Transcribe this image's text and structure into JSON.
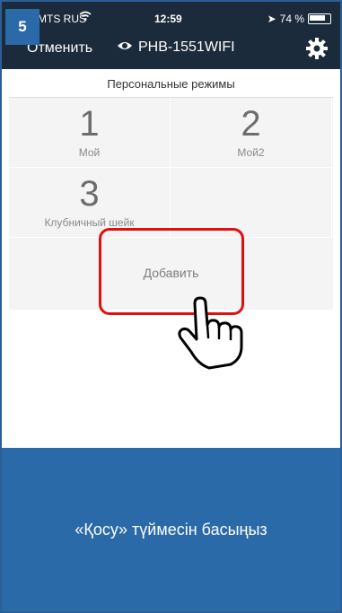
{
  "step_number": "5",
  "status_bar": {
    "carrier": "MTS RUS",
    "time": "12:59",
    "battery": "74 %"
  },
  "header": {
    "cancel_label": "Отменить",
    "device_name": "PHB-1551WIFI"
  },
  "section_title": "Персональные режимы",
  "modes": [
    {
      "number": "1",
      "name": "Мой"
    },
    {
      "number": "2",
      "name": "Мой2"
    },
    {
      "number": "3",
      "name": "Клубничный шейк"
    }
  ],
  "add_label": "Добавить",
  "instruction": "«Қосу» түймесін басыңыз",
  "icons": {
    "wifi": "wifi-icon",
    "eye": "eye-icon",
    "gear": "gear-icon",
    "location": "location-arrow-icon",
    "battery": "battery-icon",
    "hand": "pointing-hand-icon"
  },
  "colors": {
    "header_bg": "#1c2b3b",
    "accent": "#2b6aa8",
    "highlight": "#e01010"
  }
}
